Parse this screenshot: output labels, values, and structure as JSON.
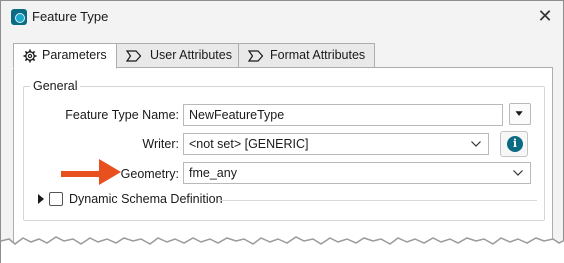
{
  "window": {
    "title": "Feature Type",
    "close_glyph": "✕"
  },
  "tabs": [
    {
      "label": "Parameters",
      "icon": "gear-icon"
    },
    {
      "label": "User Attributes",
      "icon": "tag-icon"
    },
    {
      "label": "Format Attributes",
      "icon": "tag-icon"
    }
  ],
  "general": {
    "group_label": "General",
    "feature_type_name_label": "Feature Type Name:",
    "feature_type_name_value": "NewFeatureType",
    "writer_label": "Writer:",
    "writer_value": "<not set> [GENERIC]",
    "geometry_label": "Geometry:",
    "geometry_value": "fme_any",
    "info_glyph": "i"
  },
  "dynamic_schema": {
    "label": "Dynamic Schema Definition",
    "checked": false
  },
  "colors": {
    "accent": "#0b6b83",
    "annotation_arrow": "#e8501e"
  }
}
